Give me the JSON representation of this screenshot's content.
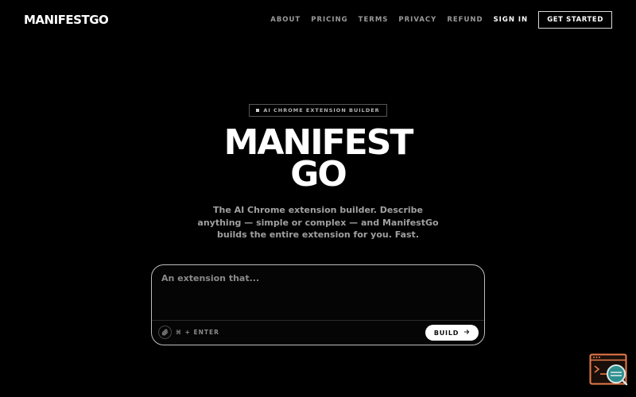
{
  "header": {
    "logo": "MANIFESTGO",
    "nav": {
      "about": "ABOUT",
      "pricing": "PRICING",
      "terms": "TERMS",
      "privacy": "PRIVACY",
      "refund": "REFUND",
      "sign_in": "SIGN IN",
      "get_started": "GET STARTED"
    }
  },
  "hero": {
    "badge": "AI CHROME EXTENSION BUILDER",
    "title_line1": "MANIFEST",
    "title_line2": "GO",
    "description": "The AI Chrome extension builder. Describe anything — simple or complex — and ManifestGo builds the entire extension for you. Fast."
  },
  "prompt": {
    "placeholder": "An extension that...",
    "value": "",
    "attach_icon": "paperclip-icon",
    "shortcut": "⌘ + ENTER",
    "build_label": "BUILD",
    "build_icon": "arrow-right-icon"
  },
  "widget": {
    "icon": "terminal-search-icon"
  },
  "colors": {
    "background": "#000000",
    "text": "#ffffff",
    "muted": "#9a9a9a",
    "widget_accent": "#e87a4a",
    "widget_teal": "#2f8f8f"
  }
}
